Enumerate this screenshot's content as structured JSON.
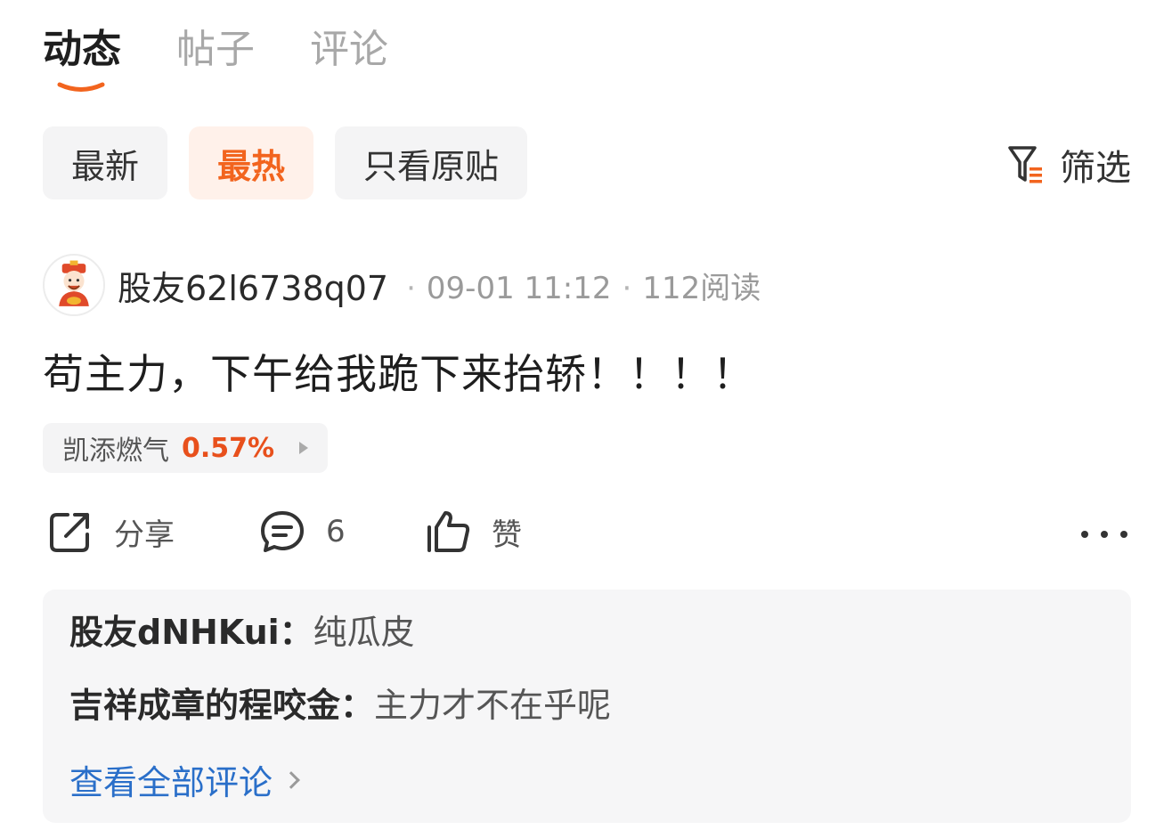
{
  "tabs": [
    {
      "label": "动态",
      "active": true
    },
    {
      "label": "帖子",
      "active": false
    },
    {
      "label": "评论",
      "active": false
    }
  ],
  "chips": [
    {
      "label": "最新",
      "active": false
    },
    {
      "label": "最热",
      "active": true
    },
    {
      "label": "只看原贴",
      "active": false
    }
  ],
  "filter": {
    "label": "筛选",
    "icon": "funnel-icon"
  },
  "post": {
    "author": "股友62l6738q07",
    "date": "09-01 11:12",
    "reads": "112阅读",
    "text": "苟主力，下午给我跪下来抬轿！！！！",
    "stock": {
      "name": "凯添燃气",
      "change": "0.57%"
    }
  },
  "actions": {
    "share": "分享",
    "comments_count": "6",
    "like": "赞"
  },
  "comments": [
    {
      "author": "股友dNHKui：",
      "text": "纯瓜皮"
    },
    {
      "author": "吉祥成章的程咬金：",
      "text": "主力才不在乎呢"
    }
  ],
  "see_all": "查看全部评论",
  "colors": {
    "accent": "#f2641e",
    "link": "#2a6fc9",
    "up": "#e8501c"
  }
}
